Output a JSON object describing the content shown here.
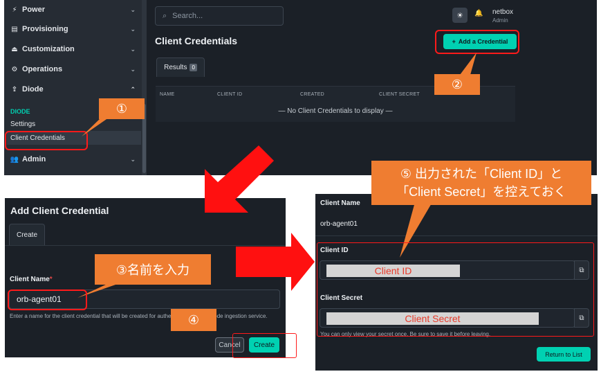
{
  "panel1": {
    "sidebar": {
      "items": [
        {
          "label": "Power",
          "icon": "power-icon"
        },
        {
          "label": "Provisioning",
          "icon": "file-icon"
        },
        {
          "label": "Customization",
          "icon": "customization-icon"
        },
        {
          "label": "Operations",
          "icon": "operations-icon"
        },
        {
          "label": "Diode",
          "icon": "upload-icon",
          "chevron": "up"
        },
        {
          "label": "Admin",
          "icon": "users-icon"
        }
      ],
      "section_label": "DIODE",
      "links": [
        "Settings",
        "Client Credentials"
      ]
    },
    "search": {
      "placeholder": "Search..."
    },
    "user": {
      "name": "netbox",
      "role": "Admin"
    },
    "page_title": "Client Credentials",
    "add_button": "Add a Credential",
    "tab": {
      "label": "Results",
      "count": "0"
    },
    "table": {
      "columns": [
        "NAME",
        "CLIENT ID",
        "CREATED",
        "CLIENT SECRET"
      ],
      "empty_message": "— No Client Credentials to display —"
    }
  },
  "panel2": {
    "title": "Add Client Credential",
    "tab": "Create",
    "field_label": "Client Name",
    "field_value": "orb-agent01",
    "help_text": "Enter a name for the client credential that will be created for authentication to the Diode ingestion service.",
    "cancel": "Cancel",
    "create": "Create"
  },
  "panel3": {
    "name_label": "Client Name",
    "name_value": "orb-agent01",
    "client_id_label": "Client ID",
    "client_id_mask": "Client ID",
    "client_secret_label": "Client Secret",
    "client_secret_mask": "Client Secret",
    "note": "You can only view your secret once. Be sure to save it before leaving.",
    "return_button": "Return to List"
  },
  "annotations": {
    "step1": "①",
    "step2": "②",
    "step3": "③名前を入力",
    "step4": "④",
    "step5_line1": "⑤ 出力された「Client ID」と",
    "step5_line2": "「Client Secret」を控えておく"
  },
  "colors": {
    "accent": "#00d1b2",
    "callout": "#ef7d31",
    "highlight": "#ff1a1a",
    "panel_bg": "#1b2027"
  }
}
